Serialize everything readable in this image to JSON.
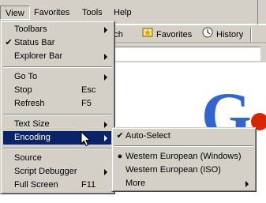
{
  "menubar": {
    "items": [
      {
        "label": "View",
        "active": true
      },
      {
        "label": "Favorites"
      },
      {
        "label": "Tools"
      },
      {
        "label": "Help"
      }
    ]
  },
  "toolbar": {
    "search_label": "Search",
    "favorites_label": "Favorites",
    "history_label": "History"
  },
  "view_menu": {
    "items": [
      {
        "label": "Toolbars",
        "submenu": true
      },
      {
        "label": "Status Bar",
        "checked": true
      },
      {
        "label": "Explorer Bar",
        "submenu": true
      },
      {
        "label": "Go To",
        "submenu": true
      },
      {
        "label": "Stop",
        "shortcut": "Esc"
      },
      {
        "label": "Refresh",
        "shortcut": "F5"
      },
      {
        "label": "Text Size",
        "submenu": true
      },
      {
        "label": "Encoding",
        "submenu": true,
        "highlighted": true
      },
      {
        "label": "Source"
      },
      {
        "label": "Script Debugger",
        "submenu": true
      },
      {
        "label": "Full Screen",
        "shortcut": "F11"
      }
    ]
  },
  "encoding_menu": {
    "items": [
      {
        "label": "Auto-Select",
        "checked": true
      },
      {
        "label": "Western European (Windows)",
        "selected": true
      },
      {
        "label": "Western European (ISO)"
      },
      {
        "label": "More",
        "submenu": true
      }
    ]
  },
  "colors": {
    "menu_bg": "#d4d0c8",
    "highlight": "#0a246a",
    "logo_blue": "#3366cc",
    "logo_red": "#d62408"
  }
}
